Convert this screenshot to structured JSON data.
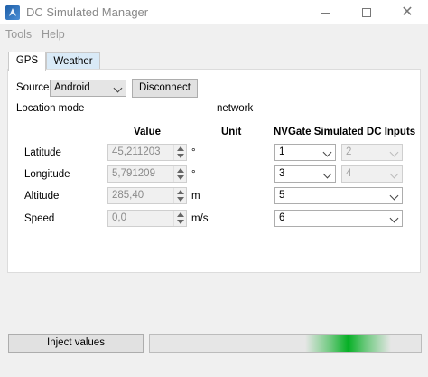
{
  "window": {
    "title": "DC Simulated Manager",
    "minimize_icon": "minimize-icon",
    "maximize_icon": "maximize-icon",
    "close_glyph": "✕"
  },
  "menu": [
    "Tools",
    "Help"
  ],
  "tabs": [
    {
      "label": "GPS",
      "active": true
    },
    {
      "label": "Weather",
      "active": false
    }
  ],
  "source": {
    "label": "Source",
    "selected": "Android",
    "disconnect_label": "Disconnect"
  },
  "location_mode": {
    "label": "Location mode",
    "value": "network"
  },
  "table": {
    "headers": {
      "value": "Value",
      "unit": "Unit",
      "inputs": "NVGate Simulated DC Inputs"
    },
    "rows": [
      {
        "label": "Latitude",
        "value": "45,211203",
        "unit": "°",
        "input1": "1",
        "input2": "2"
      },
      {
        "label": "Longitude",
        "value": "5,791209",
        "unit": "°",
        "input1": "3",
        "input2": "4"
      },
      {
        "label": "Altitude",
        "value": "285,40",
        "unit": "m",
        "input1": "5"
      },
      {
        "label": "Speed",
        "value": "0,0",
        "unit": "m/s",
        "input1": "6"
      }
    ]
  },
  "footer": {
    "inject_label": "Inject values",
    "progress_color": "#06b025"
  }
}
